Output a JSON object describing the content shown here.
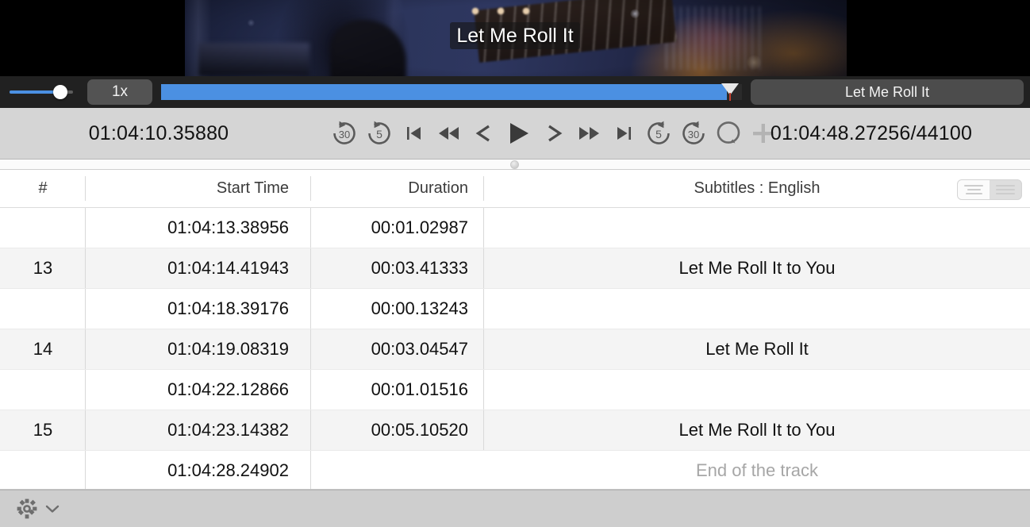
{
  "player": {
    "overlay_subtitle": "Let Me Roll It",
    "speed_label": "1x",
    "title_chip": "Let Me Roll It",
    "volume_icon": "volume-slider",
    "seek_icon": "seek-slider"
  },
  "transport": {
    "current_time": "01:04:10.35880",
    "total_time": "01:04:48.27256/44100",
    "buttons": [
      {
        "name": "back-30-seconds-button",
        "glyph": "rewind-30-icon"
      },
      {
        "name": "back-5-seconds-button",
        "glyph": "rewind-5-icon"
      },
      {
        "name": "skip-to-start-button",
        "glyph": "skip-start-icon"
      },
      {
        "name": "rewind-button",
        "glyph": "rewind-icon"
      },
      {
        "name": "step-backward-button",
        "glyph": "step-back-icon"
      },
      {
        "name": "play-button",
        "glyph": "play-icon"
      },
      {
        "name": "step-forward-button",
        "glyph": "step-forward-icon"
      },
      {
        "name": "fast-forward-button",
        "glyph": "fast-forward-icon"
      },
      {
        "name": "skip-to-end-button",
        "glyph": "skip-end-icon"
      },
      {
        "name": "forward-5-seconds-button",
        "glyph": "forward-5-icon"
      },
      {
        "name": "forward-30-seconds-button",
        "glyph": "forward-30-icon"
      },
      {
        "name": "loop-button",
        "glyph": "loop-bubble-icon"
      },
      {
        "name": "add-subtitle-button",
        "glyph": "plus-icon"
      }
    ]
  },
  "table": {
    "headers": {
      "num": "#",
      "start": "Start Time",
      "duration": "Duration",
      "text": "Subtitles : English"
    },
    "view_toggle": {
      "left_label": "left-align-view",
      "right_label": "block-view",
      "selected": "left"
    },
    "rows": [
      {
        "num": "",
        "start": "01:04:13.38956",
        "duration": "00:01.02987",
        "text": "",
        "alt": false,
        "placeholder": false
      },
      {
        "num": "13",
        "start": "01:04:14.41943",
        "duration": "00:03.41333",
        "text": "Let Me Roll It to You",
        "alt": true,
        "placeholder": false
      },
      {
        "num": "",
        "start": "01:04:18.39176",
        "duration": "00:00.13243",
        "text": "",
        "alt": false,
        "placeholder": false
      },
      {
        "num": "14",
        "start": "01:04:19.08319",
        "duration": "00:03.04547",
        "text": "Let Me Roll It",
        "alt": true,
        "placeholder": false
      },
      {
        "num": "",
        "start": "01:04:22.12866",
        "duration": "00:01.01516",
        "text": "",
        "alt": false,
        "placeholder": false
      },
      {
        "num": "15",
        "start": "01:04:23.14382",
        "duration": "00:05.10520",
        "text": "Let Me Roll It to You",
        "alt": true,
        "placeholder": false
      },
      {
        "num": "",
        "start": "01:04:28.24902",
        "duration": "",
        "text": "End of the track",
        "alt": false,
        "placeholder": true
      }
    ]
  },
  "bottom_bar": {
    "settings_icon": "gear-icon",
    "settings_chevron": "chevron-down-icon"
  }
}
